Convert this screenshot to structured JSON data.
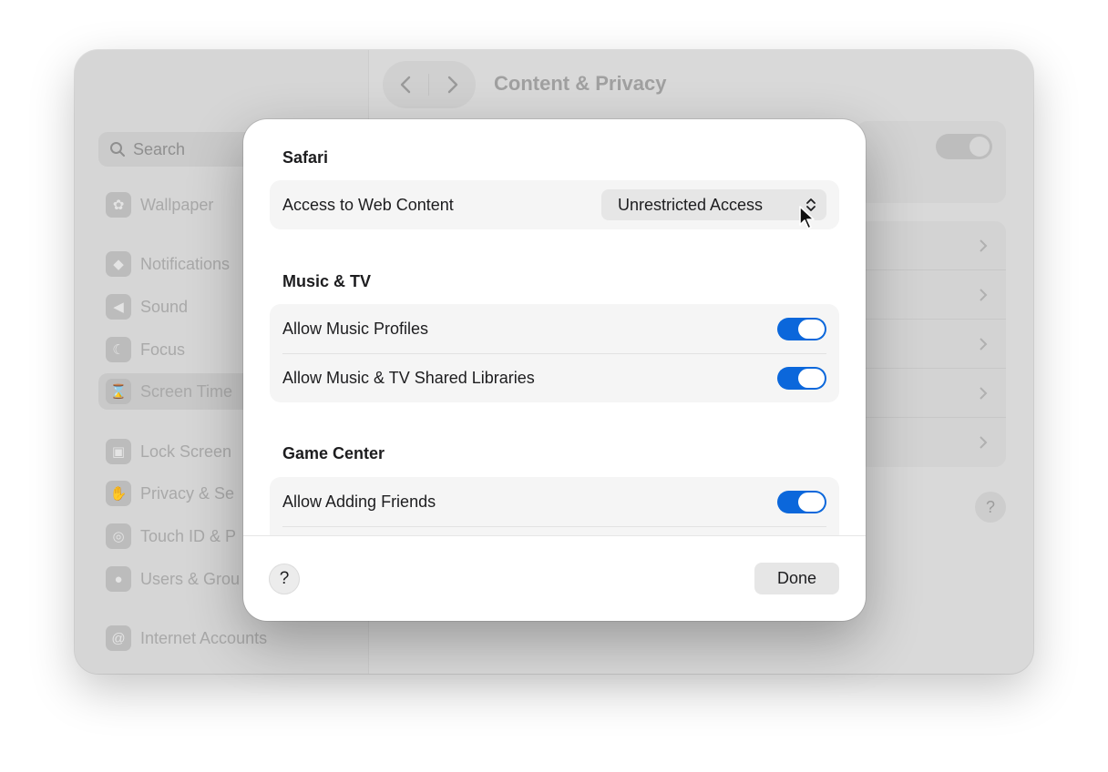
{
  "window": {
    "title": "Content & Privacy"
  },
  "sidebar": {
    "search_placeholder": "Search",
    "items": [
      {
        "label": "Wallpaper",
        "icon": "wallpaper-icon"
      },
      {
        "label": "Notifications",
        "icon": "notifications-icon"
      },
      {
        "label": "Sound",
        "icon": "sound-icon"
      },
      {
        "label": "Focus",
        "icon": "focus-icon"
      },
      {
        "label": "Screen Time",
        "icon": "hourglass-icon",
        "selected": true
      },
      {
        "label": "Lock Screen",
        "icon": "lock-icon"
      },
      {
        "label": "Privacy & Se",
        "icon": "hand-icon"
      },
      {
        "label": "Touch ID & P",
        "icon": "fingerprint-icon"
      },
      {
        "label": "Users & Grou",
        "icon": "users-icon"
      },
      {
        "label": "Internet Accounts",
        "icon": "at-icon"
      }
    ]
  },
  "background_help": "?",
  "modal": {
    "sections": [
      {
        "heading": "Safari",
        "rows": [
          {
            "label": "Access to Web Content",
            "control": "popup",
            "value": "Unrestricted Access"
          }
        ]
      },
      {
        "heading": "Music & TV",
        "rows": [
          {
            "label": "Allow Music Profiles",
            "control": "toggle",
            "on": true
          },
          {
            "label": "Allow Music & TV Shared Libraries",
            "control": "toggle",
            "on": true
          }
        ]
      },
      {
        "heading": "Game Center",
        "rows": [
          {
            "label": "Allow Adding Friends",
            "control": "toggle",
            "on": true
          }
        ]
      }
    ],
    "help_label": "?",
    "done_label": "Done"
  },
  "colors": {
    "accent": "#0b67db",
    "traffic_yellow": "#f5bd1a",
    "traffic_green": "#2fc842"
  }
}
